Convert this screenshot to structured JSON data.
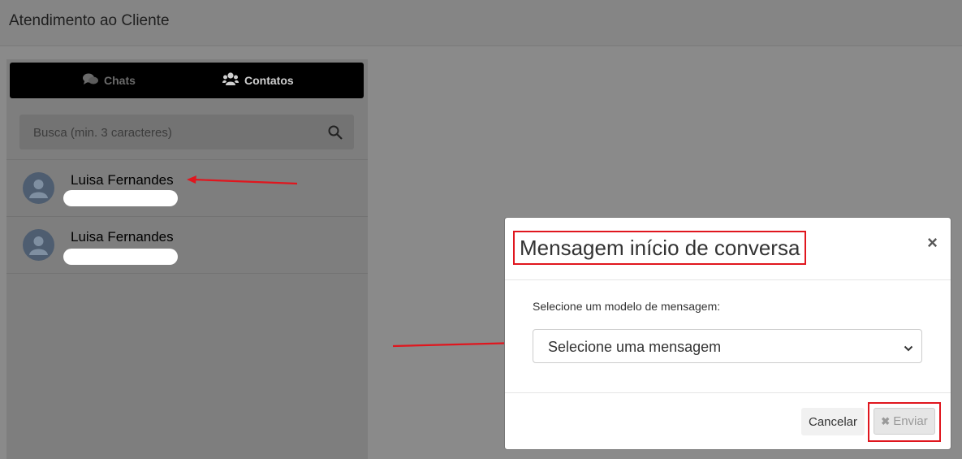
{
  "header": {
    "title": "Atendimento ao Cliente"
  },
  "tabs": [
    {
      "label": "Chats",
      "icon": "chat-bubbles-icon",
      "active": false
    },
    {
      "label": "Contatos",
      "icon": "users-icon",
      "active": true
    }
  ],
  "search": {
    "placeholder": "Busca (min. 3 caracteres)"
  },
  "contacts": [
    {
      "name": "Luisa Fernandes"
    },
    {
      "name": "Luisa Fernandes"
    }
  ],
  "modal": {
    "title": "Mensagem início de conversa",
    "select_label": "Selecione um modelo de mensagem:",
    "select_value": "Selecione uma mensagem",
    "cancel_label": "Cancelar",
    "send_label": "Enviar",
    "close_glyph": "×"
  },
  "annotation_color": "#e0161e"
}
